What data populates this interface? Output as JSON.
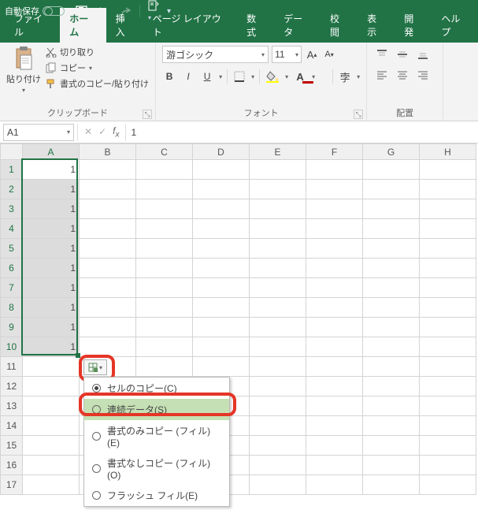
{
  "titlebar": {
    "autosave_label": "自動保存"
  },
  "tabs": [
    "ファイル",
    "ホーム",
    "挿入",
    "ページ レイアウト",
    "数式",
    "データ",
    "校閲",
    "表示",
    "開発",
    "ヘルプ"
  ],
  "active_tab": 1,
  "ribbon": {
    "clipboard": {
      "paste": "貼り付け",
      "cut": "切り取り",
      "copy": "コピー",
      "format_painter": "書式のコピー/貼り付け",
      "group_label": "クリップボード"
    },
    "font": {
      "name": "游ゴシック",
      "size": "11",
      "group_label": "フォント"
    },
    "alignment": {
      "group_label": "配置"
    }
  },
  "namebox": "A1",
  "formula": "1",
  "columns": [
    "A",
    "B",
    "C",
    "D",
    "E",
    "F",
    "G",
    "H"
  ],
  "rows": 17,
  "selected_col": 0,
  "selected_rows_from": 1,
  "selected_rows_to": 10,
  "cell_values": {
    "A1": "1",
    "A2": "1",
    "A3": "1",
    "A4": "1",
    "A5": "1",
    "A6": "1",
    "A7": "1",
    "A8": "1",
    "A9": "1",
    "A10": "1"
  },
  "autofill_menu": {
    "items": [
      {
        "label": "セルのコピー(C)",
        "checked": true
      },
      {
        "label": "連続データ(S)",
        "checked": false,
        "hover": true
      },
      {
        "label": "書式のみコピー (フィル)(E)",
        "checked": false
      },
      {
        "label": "書式なしコピー (フィル)(O)",
        "checked": false
      },
      {
        "label": "フラッシュ フィル(E)",
        "checked": false
      }
    ]
  }
}
